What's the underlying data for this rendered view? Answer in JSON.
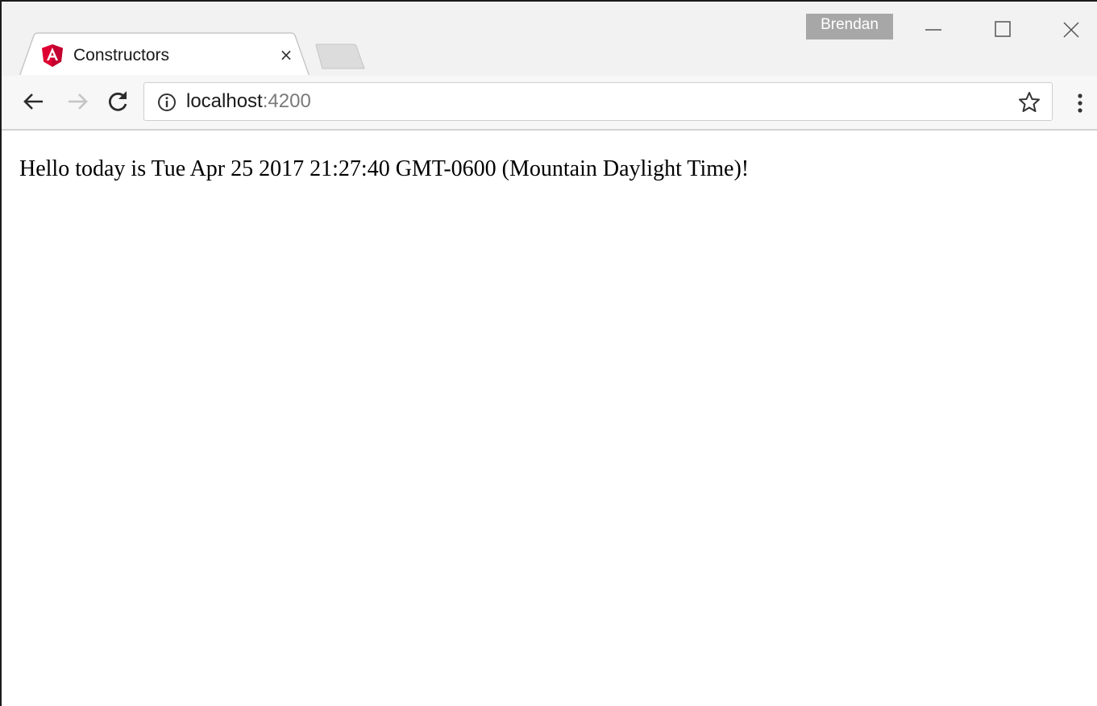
{
  "browser": {
    "profile_name": "Brendan",
    "tabs": [
      {
        "title": "Constructors",
        "favicon": "angular-icon",
        "close_label": "×",
        "active": true
      }
    ],
    "address_bar": {
      "host": "localhost",
      "port": ":4200"
    },
    "icons": {
      "back": "back-arrow-icon",
      "forward": "forward-arrow-icon",
      "reload": "reload-icon",
      "info": "info-icon",
      "bookmark": "star-icon",
      "menu": "kebab-menu-icon",
      "minimize": "minimize-icon",
      "maximize": "maximize-icon",
      "close": "close-icon"
    },
    "colors": {
      "angular_red": "#dd0031",
      "profile_badge": "#a7a7a7",
      "forward_disabled": "#c4c4c4"
    }
  },
  "page": {
    "greeting": "Hello today is Tue Apr 25 2017 21:27:40 GMT-0600 (Mountain Daylight Time)!"
  }
}
